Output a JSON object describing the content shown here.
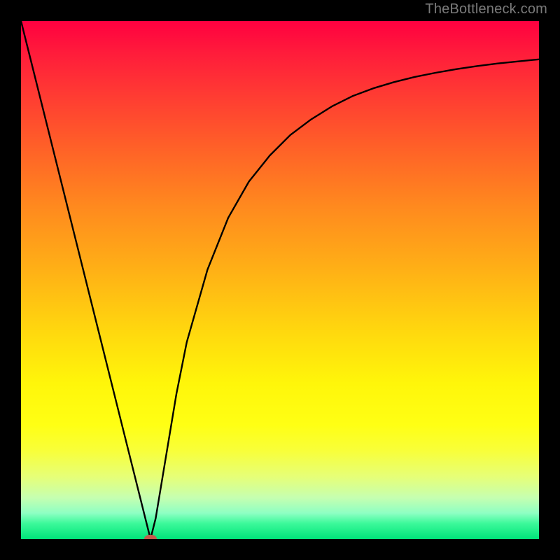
{
  "watermark": "TheBottleneck.com",
  "colors": {
    "frame": "#000000",
    "curve": "#000000",
    "marker": "#c45a4b",
    "watermark_text": "#7a7a7a"
  },
  "chart_data": {
    "type": "line",
    "title": "",
    "xlabel": "",
    "ylabel": "",
    "xlim": [
      0,
      100
    ],
    "ylim": [
      0,
      100
    ],
    "background_gradient": {
      "orientation": "vertical",
      "stops": [
        {
          "pos": 0,
          "color": "#ff0040"
        },
        {
          "pos": 50,
          "color": "#ffb016"
        },
        {
          "pos": 78,
          "color": "#ffff14"
        },
        {
          "pos": 100,
          "color": "#00e47a"
        }
      ]
    },
    "series": [
      {
        "name": "bottleneck-curve",
        "x": [
          0,
          4,
          8,
          12,
          16,
          20,
          22,
          24,
          25,
          26,
          28,
          30,
          32,
          36,
          40,
          44,
          48,
          52,
          56,
          60,
          64,
          68,
          72,
          76,
          80,
          84,
          88,
          92,
          96,
          100
        ],
        "y": [
          100,
          84,
          68,
          52,
          36,
          20,
          12,
          4,
          0,
          4,
          16,
          28,
          38,
          52,
          62,
          69,
          74,
          78,
          81,
          83.5,
          85.5,
          87,
          88.2,
          89.2,
          90,
          90.7,
          91.3,
          91.8,
          92.2,
          92.6
        ]
      }
    ],
    "marker": {
      "x": 25,
      "y": 0,
      "label": "optimal-point"
    }
  }
}
